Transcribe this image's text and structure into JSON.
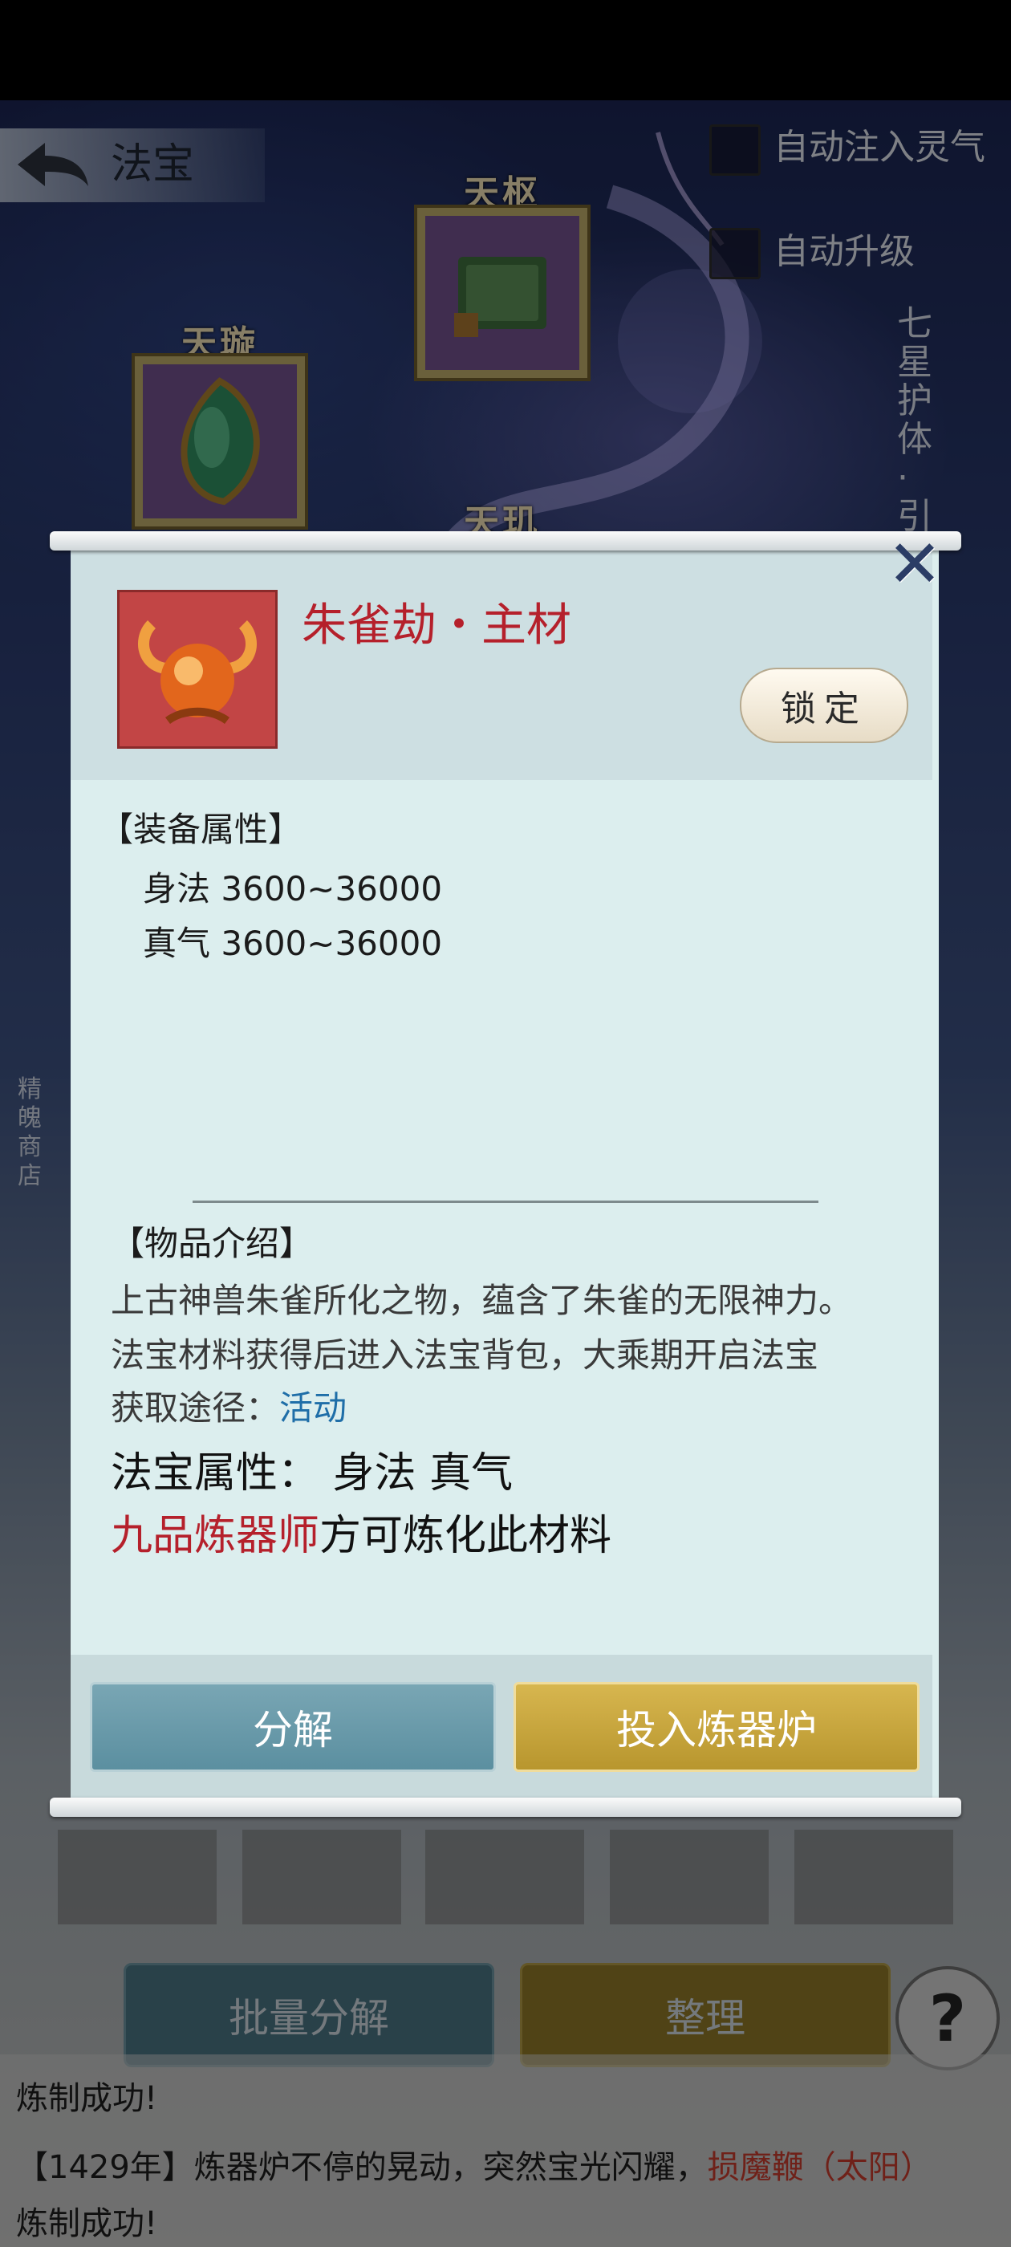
{
  "header": {
    "title": "法宝",
    "auto_inject_label": "自动注入灵气",
    "auto_upgrade_label": "自动升级",
    "vertical_text": "七星护体·引",
    "shop_text": "精魄商店"
  },
  "slots": [
    {
      "label": "天枢"
    },
    {
      "label": "天璇"
    },
    {
      "label": "天玑"
    }
  ],
  "bottom": {
    "batch_decompose_label": "批量分解",
    "sort_label": "整理",
    "help_label": "?"
  },
  "log": {
    "line1_prefix": "【1429年】炼器炉不停的晃动，突然宝光闪耀，",
    "line1_item": "损魔鞭（太阳）",
    "line1_suffix": "炼制成功!",
    "line0_suffix": "炼制成功!"
  },
  "modal": {
    "item_name": "朱雀劫・主材",
    "lock_label": "锁定",
    "close_label": "✕",
    "equip_section_title": "【装备属性】",
    "attributes": [
      {
        "name": "身法",
        "value": "3600~36000"
      },
      {
        "name": "真气",
        "value": "3600~36000"
      }
    ],
    "intro_section_title": "【物品介绍】",
    "desc_line1": "上古神兽朱雀所化之物，蕴含了朱雀的无限神力。",
    "desc_line2": "法宝材料获得后进入法宝背包，大乘期开启法宝",
    "source_label": "获取途径：",
    "source_link": "活动",
    "fabao_attr_label": "法宝属性：",
    "fabao_attr_values": "身法 真气",
    "requirement_highlight": "九品炼器师",
    "requirement_rest": "方可炼化此材料",
    "decompose_label": "分解",
    "furnace_label": "投入炼器炉"
  },
  "colors": {
    "item_name": "#b5202b",
    "link": "#1f6ea8",
    "decompose_btn": "#6a9aab",
    "furnace_btn": "#c8a63e"
  }
}
